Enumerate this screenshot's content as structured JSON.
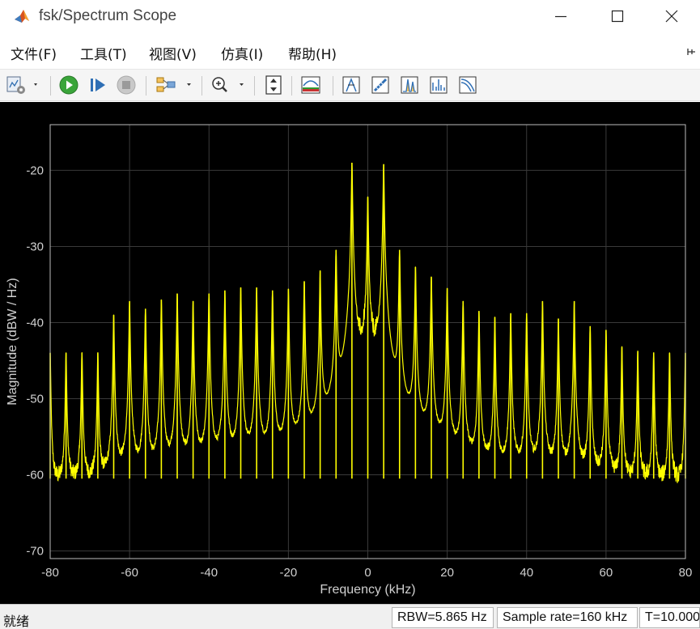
{
  "window": {
    "title": "fsk/Spectrum Scope",
    "controls": [
      "minimize",
      "maximize",
      "close"
    ]
  },
  "menu": [
    {
      "label": "文件(F)"
    },
    {
      "label": "工具(T)"
    },
    {
      "label": "视图(V)"
    },
    {
      "label": "仿真(I)"
    },
    {
      "label": "帮助(H)"
    }
  ],
  "toolbar": {
    "icons": [
      "scope-settings-icon",
      "run-icon",
      "step-forward-icon",
      "stop-icon",
      "signal-highlight-icon",
      "zoom-in-icon",
      "scale-axes-icon",
      "spectrum-settings-icon",
      "data-cursor-icon",
      "measurement-icon",
      "peak-finder-icon",
      "distortion-icon",
      "ccdf-icon"
    ]
  },
  "status": {
    "state": "就绪",
    "rbw": "RBW=5.865 Hz",
    "sample_rate": "Sample rate=160 kHz",
    "time": "T=10.000"
  },
  "chart_data": {
    "type": "line",
    "xlabel": "Frequency (kHz)",
    "ylabel": "Magnitude (dBW / Hz)",
    "xlim": [
      -80,
      80
    ],
    "ylim": [
      -71,
      -14
    ],
    "xticks": [
      -80,
      -60,
      -40,
      -20,
      0,
      20,
      40,
      60,
      80
    ],
    "yticks": [
      -70,
      -60,
      -50,
      -40,
      -30,
      -20
    ],
    "grid": true,
    "background": "#000000",
    "line_color": "#ffff00",
    "noise_floor": {
      "min": -64.5,
      "max": -60.5
    },
    "center_band": {
      "from": -4.5,
      "to": 4.5,
      "level_at_center": -46
    },
    "peaks": [
      {
        "x": -80,
        "y": -44
      },
      {
        "x": -76,
        "y": -44
      },
      {
        "x": -72,
        "y": -44
      },
      {
        "x": -68,
        "y": -44
      },
      {
        "x": -64,
        "y": -39
      },
      {
        "x": -60,
        "y": -37.2
      },
      {
        "x": -56,
        "y": -38.2
      },
      {
        "x": -52,
        "y": -37
      },
      {
        "x": -48,
        "y": -36.2
      },
      {
        "x": -44,
        "y": -37.2
      },
      {
        "x": -40,
        "y": -36.2
      },
      {
        "x": -36,
        "y": -35.8
      },
      {
        "x": -32,
        "y": -35.4
      },
      {
        "x": -28,
        "y": -35.4
      },
      {
        "x": -24,
        "y": -35.8
      },
      {
        "x": -20,
        "y": -35.6
      },
      {
        "x": -16,
        "y": -34.6
      },
      {
        "x": -12,
        "y": -33.2
      },
      {
        "x": -8,
        "y": -30.5
      },
      {
        "x": -4,
        "y": -19
      },
      {
        "x": 0,
        "y": -23.5
      },
      {
        "x": 4,
        "y": -19.2
      },
      {
        "x": 8,
        "y": -30.5
      },
      {
        "x": 12,
        "y": -32.7
      },
      {
        "x": 16,
        "y": -34
      },
      {
        "x": 20,
        "y": -35.5
      },
      {
        "x": 24,
        "y": -37.2
      },
      {
        "x": 28,
        "y": -38.5
      },
      {
        "x": 32,
        "y": -39.3
      },
      {
        "x": 36,
        "y": -38.8
      },
      {
        "x": 40,
        "y": -38.8
      },
      {
        "x": 44,
        "y": -37.2
      },
      {
        "x": 48,
        "y": -39.5
      },
      {
        "x": 52,
        "y": -37.2
      },
      {
        "x": 56,
        "y": -40.5
      },
      {
        "x": 60,
        "y": -41
      },
      {
        "x": 64,
        "y": -43.2
      },
      {
        "x": 68,
        "y": -43.8
      },
      {
        "x": 72,
        "y": -44
      },
      {
        "x": 76,
        "y": -44
      },
      {
        "x": 80,
        "y": -44
      }
    ]
  }
}
